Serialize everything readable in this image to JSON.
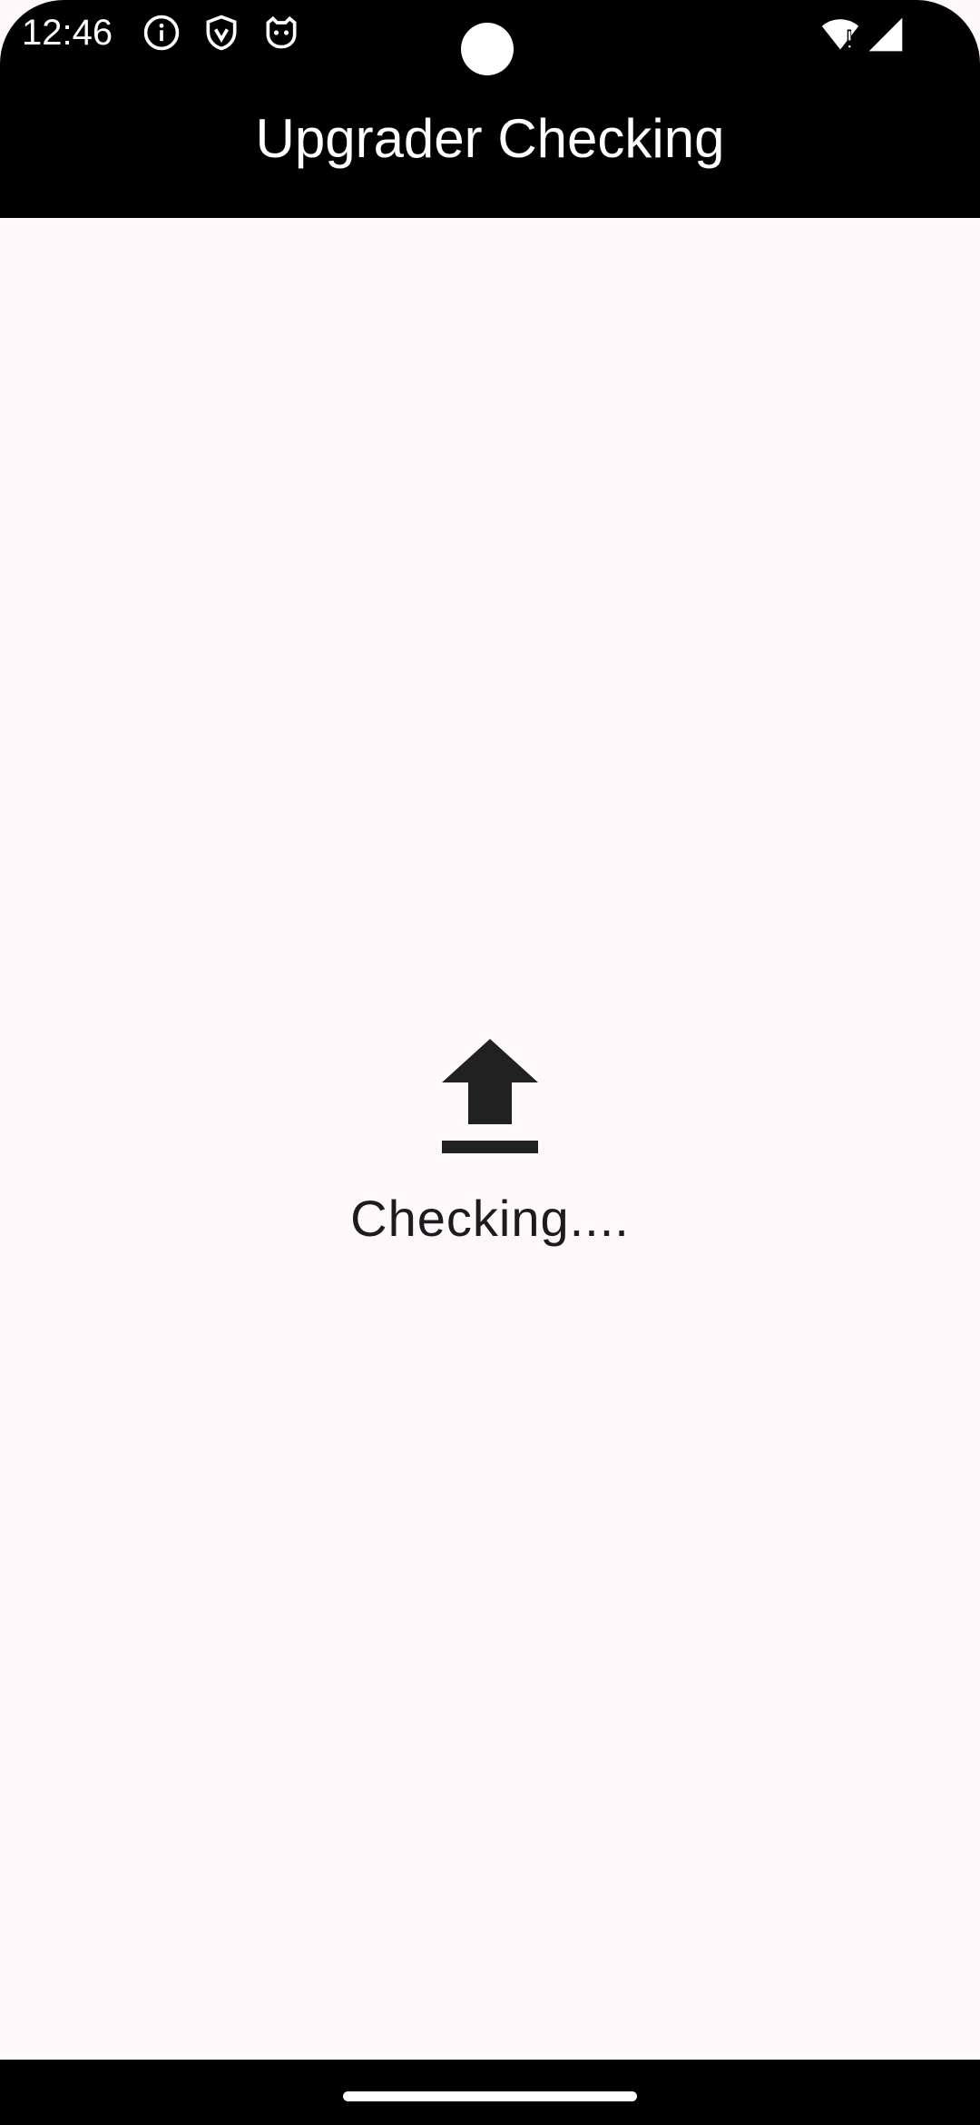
{
  "status_bar": {
    "time": "12:46",
    "left_icons": [
      "info-icon",
      "shield-icon",
      "cat-face-icon"
    ],
    "right_icons": [
      "wifi-alert-icon",
      "signal-icon"
    ]
  },
  "app_bar": {
    "title": "Upgrader Checking"
  },
  "content": {
    "icon": "upload-icon",
    "status_text": "Checking...."
  },
  "colors": {
    "app_bar_background": "#000000",
    "app_bar_text": "#FFFFFF",
    "page_background": "#FFF8FB",
    "content_text": "#1D1B20",
    "icon_color": "#212121"
  }
}
